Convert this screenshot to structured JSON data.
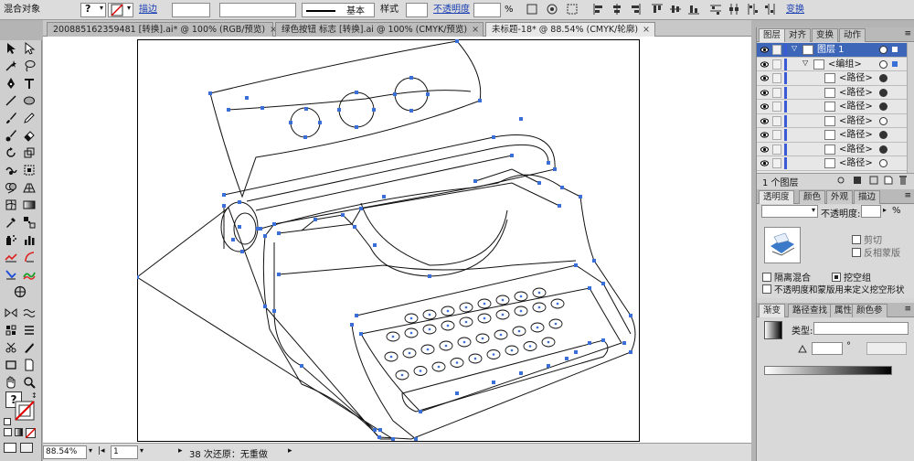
{
  "control": {
    "object_type": "混合对象",
    "stroke_link": "描边",
    "stroke_style_label": "基本",
    "style_label": "样式",
    "opacity_link": "不透明度",
    "opacity_value": "",
    "opacity_unit": "%",
    "transform_link": "变换",
    "fill_question": "?"
  },
  "tabs": [
    {
      "label": "200885162359481 [转换].ai* @ 100% (RGB/预览)",
      "active": false
    },
    {
      "label": "绿色按钮 标志 [转换].ai @ 100% (CMYK/预览)",
      "active": false
    },
    {
      "label": "未标题-18* @ 88.54% (CMYK/轮廓)",
      "active": true
    }
  ],
  "tab_close": "×",
  "status": {
    "zoom": "88.54%",
    "page": "1",
    "message": "38 次还原：无重做"
  },
  "layers_panel": {
    "tabs": [
      "图层",
      "对齐",
      "变换",
      "动作"
    ],
    "rows": [
      {
        "name": "图层 1",
        "level": 0,
        "selected": true,
        "target": "hollow"
      },
      {
        "name": "<编组>",
        "level": 1,
        "selected": false,
        "target": "hollow"
      },
      {
        "name": "<路径>",
        "level": 2,
        "selected": false,
        "target": "filled"
      },
      {
        "name": "<路径>",
        "level": 2,
        "selected": false,
        "target": "filled"
      },
      {
        "name": "<路径>",
        "level": 2,
        "selected": false,
        "target": "filled"
      },
      {
        "name": "<路径>",
        "level": 2,
        "selected": false,
        "target": "hollow"
      },
      {
        "name": "<路径>",
        "level": 2,
        "selected": false,
        "target": "filled"
      },
      {
        "name": "<路径>",
        "level": 2,
        "selected": false,
        "target": "filled"
      },
      {
        "name": "<路径>",
        "level": 2,
        "selected": false,
        "target": "hollow"
      }
    ],
    "footer": "1 个图层"
  },
  "transparency_panel": {
    "tabs": [
      "透明度",
      "颜色",
      "外观",
      "描边"
    ],
    "blend_mode": "",
    "opacity_label": "不透明度:",
    "opacity_value": "",
    "opacity_unit": "%",
    "clip_label": "剪切",
    "invert_mask_label": "反相蒙版",
    "isolate_blend_label": "隔离混合",
    "knockout_group_label": "挖空组",
    "opacity_mask_label": "不透明度和蒙版用来定义挖空形状"
  },
  "gradient_panel": {
    "tabs": [
      "渐变",
      "路径查找",
      "属性",
      "颜色参"
    ],
    "type_label": "类型:",
    "type_value": "",
    "angle_symbol": "°"
  },
  "colors": {
    "anchor": "#3a6fd8",
    "selected_layer": "#3d66b9",
    "link": "#1a3fb3"
  }
}
